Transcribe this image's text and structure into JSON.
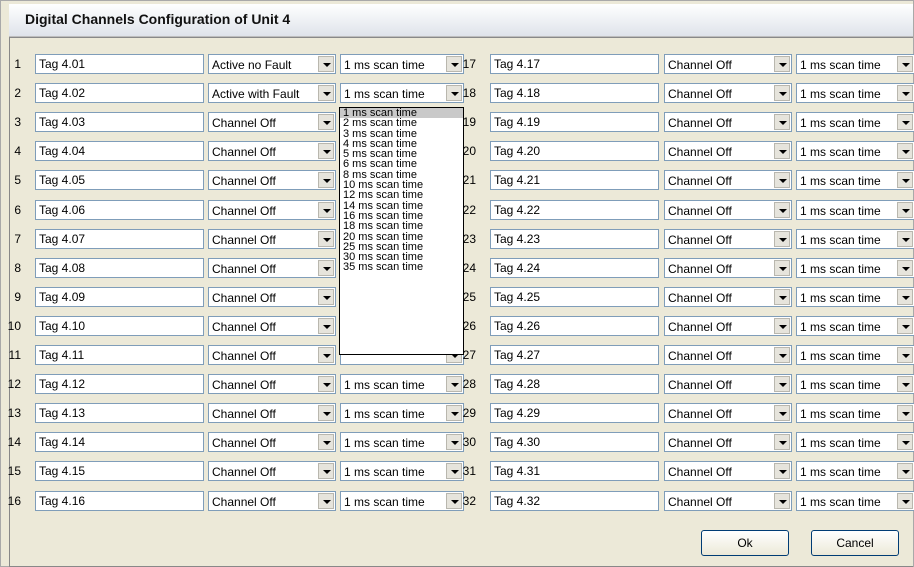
{
  "window": {
    "title": "Digital Channels Configuration of Unit 4"
  },
  "channels": [
    {
      "num": "1",
      "tag": "Tag 4.01",
      "mode": "Active no Fault",
      "scan": "1 ms scan time"
    },
    {
      "num": "2",
      "tag": "Tag 4.02",
      "mode": "Active with Fault",
      "scan": "1 ms scan time"
    },
    {
      "num": "3",
      "tag": "Tag 4.03",
      "mode": "Channel Off",
      "scan": ""
    },
    {
      "num": "4",
      "tag": "Tag 4.04",
      "mode": "Channel Off",
      "scan": ""
    },
    {
      "num": "5",
      "tag": "Tag 4.05",
      "mode": "Channel Off",
      "scan": ""
    },
    {
      "num": "6",
      "tag": "Tag 4.06",
      "mode": "Channel Off",
      "scan": ""
    },
    {
      "num": "7",
      "tag": "Tag 4.07",
      "mode": "Channel Off",
      "scan": ""
    },
    {
      "num": "8",
      "tag": "Tag 4.08",
      "mode": "Channel Off",
      "scan": ""
    },
    {
      "num": "9",
      "tag": "Tag 4.09",
      "mode": "Channel Off",
      "scan": ""
    },
    {
      "num": "10",
      "tag": "Tag 4.10",
      "mode": "Channel Off",
      "scan": ""
    },
    {
      "num": "11",
      "tag": "Tag 4.11",
      "mode": "Channel Off",
      "scan": ""
    },
    {
      "num": "12",
      "tag": "Tag 4.12",
      "mode": "Channel Off",
      "scan": "1 ms scan time"
    },
    {
      "num": "13",
      "tag": "Tag 4.13",
      "mode": "Channel Off",
      "scan": "1 ms scan time"
    },
    {
      "num": "14",
      "tag": "Tag 4.14",
      "mode": "Channel Off",
      "scan": "1 ms scan time"
    },
    {
      "num": "15",
      "tag": "Tag 4.15",
      "mode": "Channel Off",
      "scan": "1 ms scan time"
    },
    {
      "num": "16",
      "tag": "Tag 4.16",
      "mode": "Channel Off",
      "scan": "1 ms scan time"
    },
    {
      "num": "17",
      "tag": "Tag 4.17",
      "mode": "Channel Off",
      "scan": "1 ms scan time"
    },
    {
      "num": "18",
      "tag": "Tag 4.18",
      "mode": "Channel Off",
      "scan": "1 ms scan time"
    },
    {
      "num": "19",
      "tag": "Tag 4.19",
      "mode": "Channel Off",
      "scan": "1 ms scan time"
    },
    {
      "num": "20",
      "tag": "Tag 4.20",
      "mode": "Channel Off",
      "scan": "1 ms scan time"
    },
    {
      "num": "21",
      "tag": "Tag 4.21",
      "mode": "Channel Off",
      "scan": "1 ms scan time"
    },
    {
      "num": "22",
      "tag": "Tag 4.22",
      "mode": "Channel Off",
      "scan": "1 ms scan time"
    },
    {
      "num": "23",
      "tag": "Tag 4.23",
      "mode": "Channel Off",
      "scan": "1 ms scan time"
    },
    {
      "num": "24",
      "tag": "Tag 4.24",
      "mode": "Channel Off",
      "scan": "1 ms scan time"
    },
    {
      "num": "25",
      "tag": "Tag 4.25",
      "mode": "Channel Off",
      "scan": "1 ms scan time"
    },
    {
      "num": "26",
      "tag": "Tag 4.26",
      "mode": "Channel Off",
      "scan": "1 ms scan time"
    },
    {
      "num": "27",
      "tag": "Tag 4.27",
      "mode": "Channel Off",
      "scan": "1 ms scan time"
    },
    {
      "num": "28",
      "tag": "Tag 4.28",
      "mode": "Channel Off",
      "scan": "1 ms scan time"
    },
    {
      "num": "29",
      "tag": "Tag 4.29",
      "mode": "Channel Off",
      "scan": "1 ms scan time"
    },
    {
      "num": "30",
      "tag": "Tag 4.30",
      "mode": "Channel Off",
      "scan": "1 ms scan time"
    },
    {
      "num": "31",
      "tag": "Tag 4.31",
      "mode": "Channel Off",
      "scan": "1 ms scan time"
    },
    {
      "num": "32",
      "tag": "Tag 4.32",
      "mode": "Channel Off",
      "scan": "1 ms scan time"
    }
  ],
  "dropdown": {
    "selected_index": 0,
    "options": [
      "1 ms scan time",
      "2 ms scan time",
      "3 ms scan time",
      "4 ms scan time",
      "5 ms scan time",
      "6 ms scan time",
      "8 ms scan time",
      "10 ms scan time",
      "12 ms scan time",
      "14 ms scan time",
      "16 ms scan time",
      "18 ms scan time",
      "20 ms scan time",
      "25 ms scan time",
      "30 ms scan time",
      "35 ms scan time"
    ]
  },
  "buttons": {
    "ok": "Ok",
    "cancel": "Cancel"
  }
}
